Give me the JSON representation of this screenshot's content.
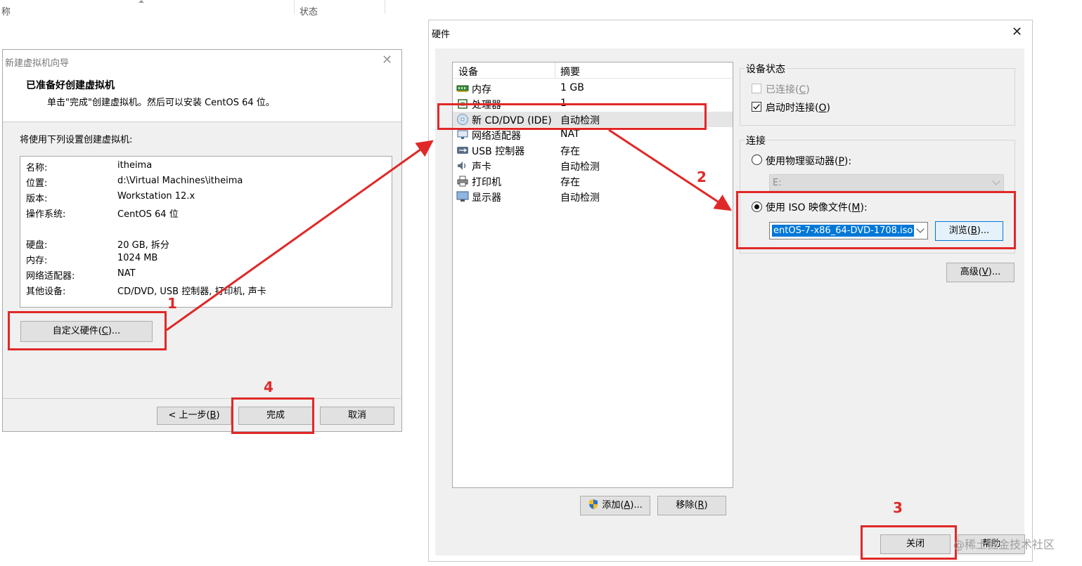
{
  "background": {
    "col_name": "称",
    "col_status": "状态"
  },
  "wizard": {
    "title": "新建虚拟机向导",
    "heading": "已准备好创建虚拟机",
    "subheading": "单击\"完成\"创建虚拟机。然后可以安装 CentOS 64 位。",
    "intro": "将使用下列设置创建虚拟机:",
    "summary": [
      {
        "key": "名称:",
        "value": "itheima"
      },
      {
        "key": "位置:",
        "value": "d:\\Virtual Machines\\itheima"
      },
      {
        "key": "版本:",
        "value": "Workstation 12.x"
      },
      {
        "key": "操作系统:",
        "value": "CentOS 64 位"
      },
      {
        "key": "硬盘:",
        "value": "20 GB, 拆分"
      },
      {
        "key": "内存:",
        "value": "1024 MB"
      },
      {
        "key": "网络适配器:",
        "value": "NAT"
      },
      {
        "key": "其他设备:",
        "value": "CD/DVD, USB 控制器, 打印机, 声卡"
      }
    ],
    "customize_button": {
      "text": "自定义硬件(",
      "hotkey": "C",
      "suffix": ")..."
    },
    "back_button": {
      "text": "< 上一步(",
      "hotkey": "B",
      "suffix": ")"
    },
    "finish_button": "完成",
    "cancel_button": "取消"
  },
  "hardware": {
    "title": "硬件",
    "columns": {
      "device": "设备",
      "summary": "摘要"
    },
    "devices": [
      {
        "name": "内存",
        "summary": "1 GB",
        "icon": "memory-icon"
      },
      {
        "name": "处理器",
        "summary": "1",
        "icon": "processor-icon"
      },
      {
        "name": "新 CD/DVD (IDE)",
        "summary": "自动检测",
        "icon": "cd-dvd-icon",
        "selected": true
      },
      {
        "name": "网络适配器",
        "summary": "NAT",
        "icon": "network-adapter-icon"
      },
      {
        "name": "USB 控制器",
        "summary": "存在",
        "icon": "usb-icon"
      },
      {
        "name": "声卡",
        "summary": "自动检测",
        "icon": "sound-card-icon"
      },
      {
        "name": "打印机",
        "summary": "存在",
        "icon": "printer-icon"
      },
      {
        "name": "显示器",
        "summary": "自动检测",
        "icon": "display-icon"
      }
    ],
    "device_status": {
      "label": "设备状态",
      "connected": {
        "text": "已连接(",
        "hotkey": "C",
        "suffix": ")",
        "checked": false,
        "enabled": false
      },
      "connect_at_power_on": {
        "text": "启动时连接(",
        "hotkey": "O",
        "suffix": ")",
        "checked": true
      }
    },
    "connection": {
      "label": "连接",
      "use_physical": {
        "text": "使用物理驱动器(",
        "hotkey": "P",
        "suffix": "):",
        "selected": false
      },
      "physical_drive_value": "E:",
      "use_iso": {
        "text": "使用 ISO 映像文件(",
        "hotkey": "M",
        "suffix": "):",
        "selected": true
      },
      "iso_path": "entOS-7-x86_64-DVD-1708.iso",
      "browse_button": {
        "text": "浏览(",
        "hotkey": "B",
        "suffix": ")..."
      }
    },
    "advanced_button": {
      "text": "高级(",
      "hotkey": "V",
      "suffix": ")..."
    },
    "add_button": {
      "text": "添加(",
      "hotkey": "A",
      "suffix": ")..."
    },
    "remove_button": {
      "text": "移除(",
      "hotkey": "R",
      "suffix": ")"
    },
    "close_button": "关闭",
    "help_button": "帮助"
  },
  "annotations": {
    "step1": "1",
    "step2": "2",
    "step3": "3",
    "step4": "4",
    "color": "#e02828"
  },
  "watermark": "@稀土掘金技术社区"
}
